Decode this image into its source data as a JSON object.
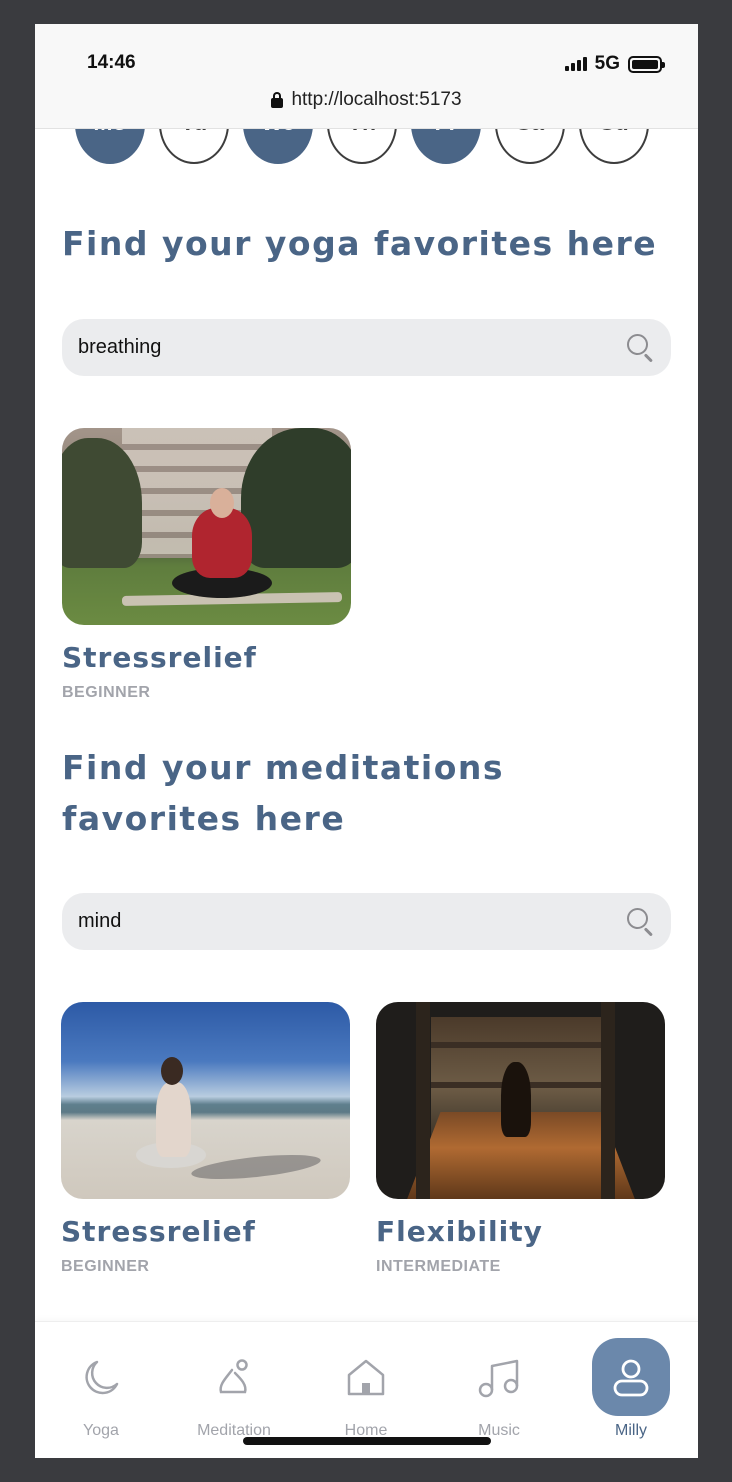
{
  "status": {
    "time": "14:46",
    "network": "5G",
    "url": "http://localhost:5173"
  },
  "days": [
    {
      "label": "Mo",
      "active": true
    },
    {
      "label": "Tu",
      "active": false
    },
    {
      "label": "We",
      "active": true
    },
    {
      "label": "Th",
      "active": false
    },
    {
      "label": "Fr",
      "active": true
    },
    {
      "label": "Sa",
      "active": false
    },
    {
      "label": "Su",
      "active": false
    }
  ],
  "yoga": {
    "heading": "Find your yoga favorites here",
    "search_value": "breathing",
    "results": [
      {
        "title": "Stressrelief",
        "level": "BEGINNER"
      }
    ]
  },
  "meditation": {
    "heading": "Find your meditations favorites here",
    "search_value": "mind",
    "results": [
      {
        "title": "Stressrelief",
        "level": "BEGINNER"
      },
      {
        "title": "Flexibility",
        "level": "INTERMEDIATE"
      }
    ]
  },
  "nav": {
    "items": [
      {
        "label": "Yoga",
        "icon": "moon-icon"
      },
      {
        "label": "Meditation",
        "icon": "meditation-icon"
      },
      {
        "label": "Home",
        "icon": "home-icon"
      },
      {
        "label": "Music",
        "icon": "music-icon"
      },
      {
        "label": "Milly",
        "icon": "profile-icon",
        "active": true
      }
    ]
  },
  "colors": {
    "accent": "#4a6586",
    "active_pill": "#6b88ab",
    "muted": "#a2a4ab",
    "search_bg": "#ebecee"
  }
}
